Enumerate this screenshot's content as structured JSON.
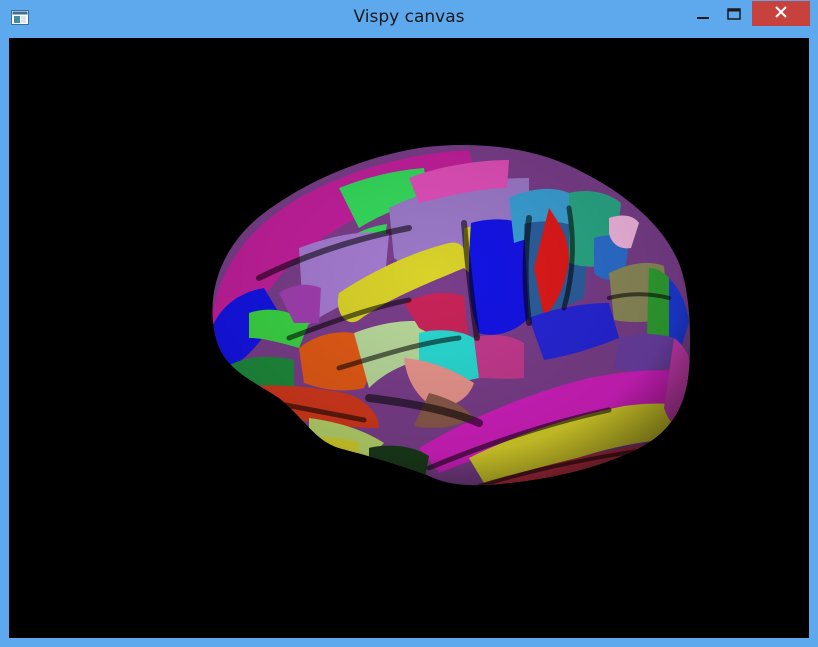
{
  "window": {
    "title": "Vispy canvas",
    "frame_color": "#5ea9ee",
    "close_button_color": "#c8423d"
  },
  "titlebar": {
    "app_icon": "app-window-icon",
    "minimize_icon": "minimize-icon",
    "maximize_icon": "maximize-icon",
    "close_icon": "close-icon"
  },
  "canvas": {
    "background": "#000000",
    "content": "brain-cortex-parcellation-render"
  }
}
